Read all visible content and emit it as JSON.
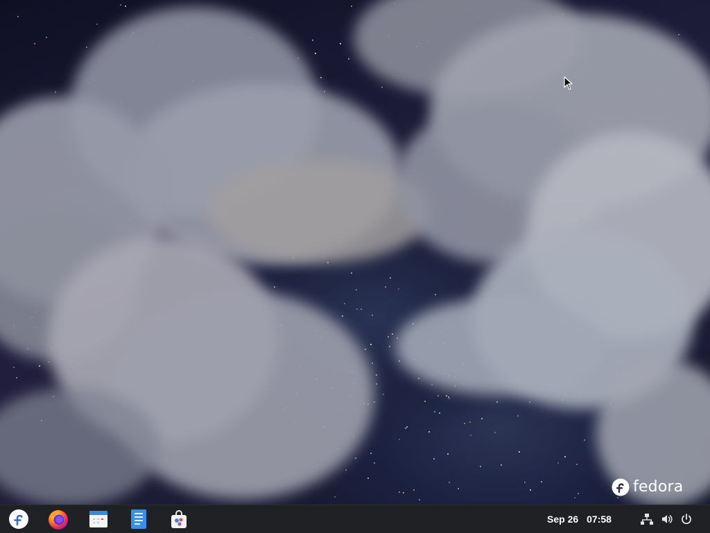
{
  "desktop": {
    "wallpaper": "night-sky-clouds",
    "branding": {
      "icon": "fedora-logo-icon",
      "text": "fedora"
    }
  },
  "taskbar": {
    "dock": [
      {
        "name": "fedora-menu",
        "icon": "fedora-logo-icon"
      },
      {
        "name": "firefox",
        "icon": "firefox-icon"
      },
      {
        "name": "calendar",
        "icon": "calendar-app-icon"
      },
      {
        "name": "text-editor",
        "icon": "document-app-icon"
      },
      {
        "name": "software",
        "icon": "software-store-icon"
      }
    ],
    "clock": {
      "date": "Sep 26",
      "time": "07:58"
    },
    "tray": [
      {
        "name": "network",
        "icon": "network-icon"
      },
      {
        "name": "volume",
        "icon": "volume-icon"
      },
      {
        "name": "power",
        "icon": "power-icon"
      }
    ]
  },
  "colors": {
    "taskbar_bg": "#202124",
    "fedora_blue": "#51a2da",
    "text": "#ffffff"
  }
}
